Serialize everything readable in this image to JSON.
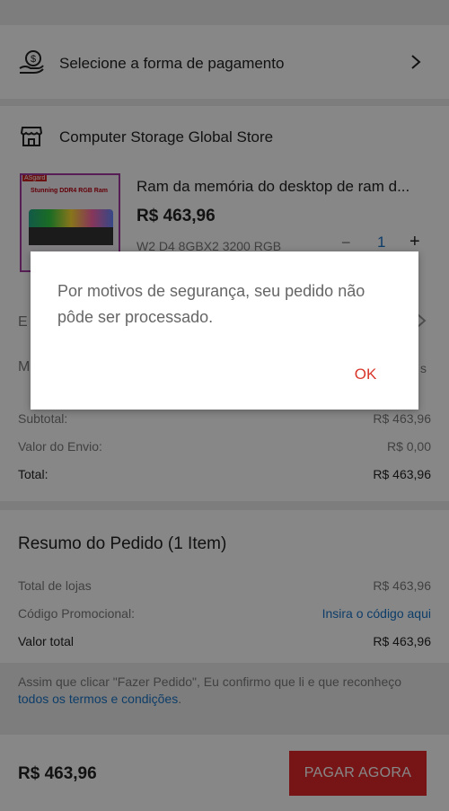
{
  "payment": {
    "label": "Selecione a forma de pagamento"
  },
  "store": {
    "name": "Computer Storage Global Store"
  },
  "product": {
    "title": "Ram da memória do desktop de ram d...",
    "price": "R$ 463,96",
    "variant": "W2 D4 8GBX2 3200 RGB",
    "quantity": "1",
    "image_text": "Stunning DDR4 RGB Ram",
    "image_brand": "ASgard"
  },
  "hidden_rows": {
    "shipping_partial": "E",
    "message_partial": "M",
    "message_right_partial": "s"
  },
  "totals": {
    "subtotal_label": "Subtotal:",
    "subtotal_value": "R$ 463,96",
    "shipping_label": "Valor do Envio:",
    "shipping_value": "R$ 0,00",
    "total_label": "Total:",
    "total_value": "R$ 463,96"
  },
  "summary": {
    "title": "Resumo do Pedido (1 Item)",
    "stores_label": "Total de lojas",
    "stores_value": "R$ 463,96",
    "promo_label": "Código Promocional:",
    "promo_link": "Insira o código aqui",
    "total_label": "Valor total",
    "total_value": "R$ 463,96"
  },
  "terms": {
    "text": "Assim que clicar \"Fazer Pedido\", Eu confirmo que li e que reconheço ",
    "link": "todos os termos e condições",
    "end": "."
  },
  "footer": {
    "price": "R$ 463,96",
    "button": "PAGAR AGORA"
  },
  "dialog": {
    "message": "Por motivos de segurança, seu pedido não pôde ser processado.",
    "ok": "OK"
  },
  "colors": {
    "accent_red": "#e0292b",
    "dialog_ok": "#d9362b",
    "link_blue": "#1a73c6"
  }
}
